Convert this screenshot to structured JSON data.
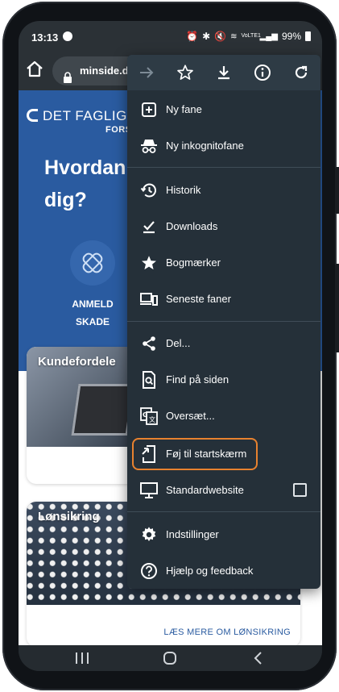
{
  "status": {
    "time": "13:13",
    "battery": "99%",
    "network": "VoLTE1"
  },
  "browser": {
    "url": "minside.det"
  },
  "page": {
    "logo_text": "DET FAGLIGE",
    "logo_sub": "FORS",
    "hero_title_line1": "Hvordan",
    "hero_title_line2": "dig?",
    "claim_label_line1": "ANMELD",
    "claim_label_line2": "SKADE",
    "cards": [
      {
        "title": "Kundefordele",
        "link": ""
      },
      {
        "title": "Lønsikring",
        "link": "LÆS MERE OM LØNSIKRING"
      }
    ]
  },
  "menu": {
    "toolbar": [
      "forward-icon",
      "star-icon",
      "download-icon",
      "info-icon",
      "reload-icon"
    ],
    "items": [
      {
        "label": "Ny fane",
        "icon": "new-tab-icon"
      },
      {
        "label": "Ny inkognitofane",
        "icon": "incognito-icon"
      },
      {
        "label": "Historik",
        "icon": "history-icon"
      },
      {
        "label": "Downloads",
        "icon": "downloads-icon"
      },
      {
        "label": "Bogmærker",
        "icon": "bookmarks-icon"
      },
      {
        "label": "Seneste faner",
        "icon": "recent-tabs-icon"
      },
      {
        "label": "Del...",
        "icon": "share-icon"
      },
      {
        "label": "Find på siden",
        "icon": "find-in-page-icon"
      },
      {
        "label": "Oversæt...",
        "icon": "translate-icon"
      },
      {
        "label": "Føj til startskærm",
        "icon": "add-to-home-icon"
      },
      {
        "label": "Standardwebsite",
        "icon": "desktop-icon",
        "checked": false
      },
      {
        "label": "Indstillinger",
        "icon": "settings-icon"
      },
      {
        "label": "Hjælp og feedback",
        "icon": "help-icon"
      }
    ],
    "highlight_color": "#e8822f"
  },
  "colors": {
    "brand_blue": "#2a5ba0",
    "menu_bg": "#253039"
  }
}
